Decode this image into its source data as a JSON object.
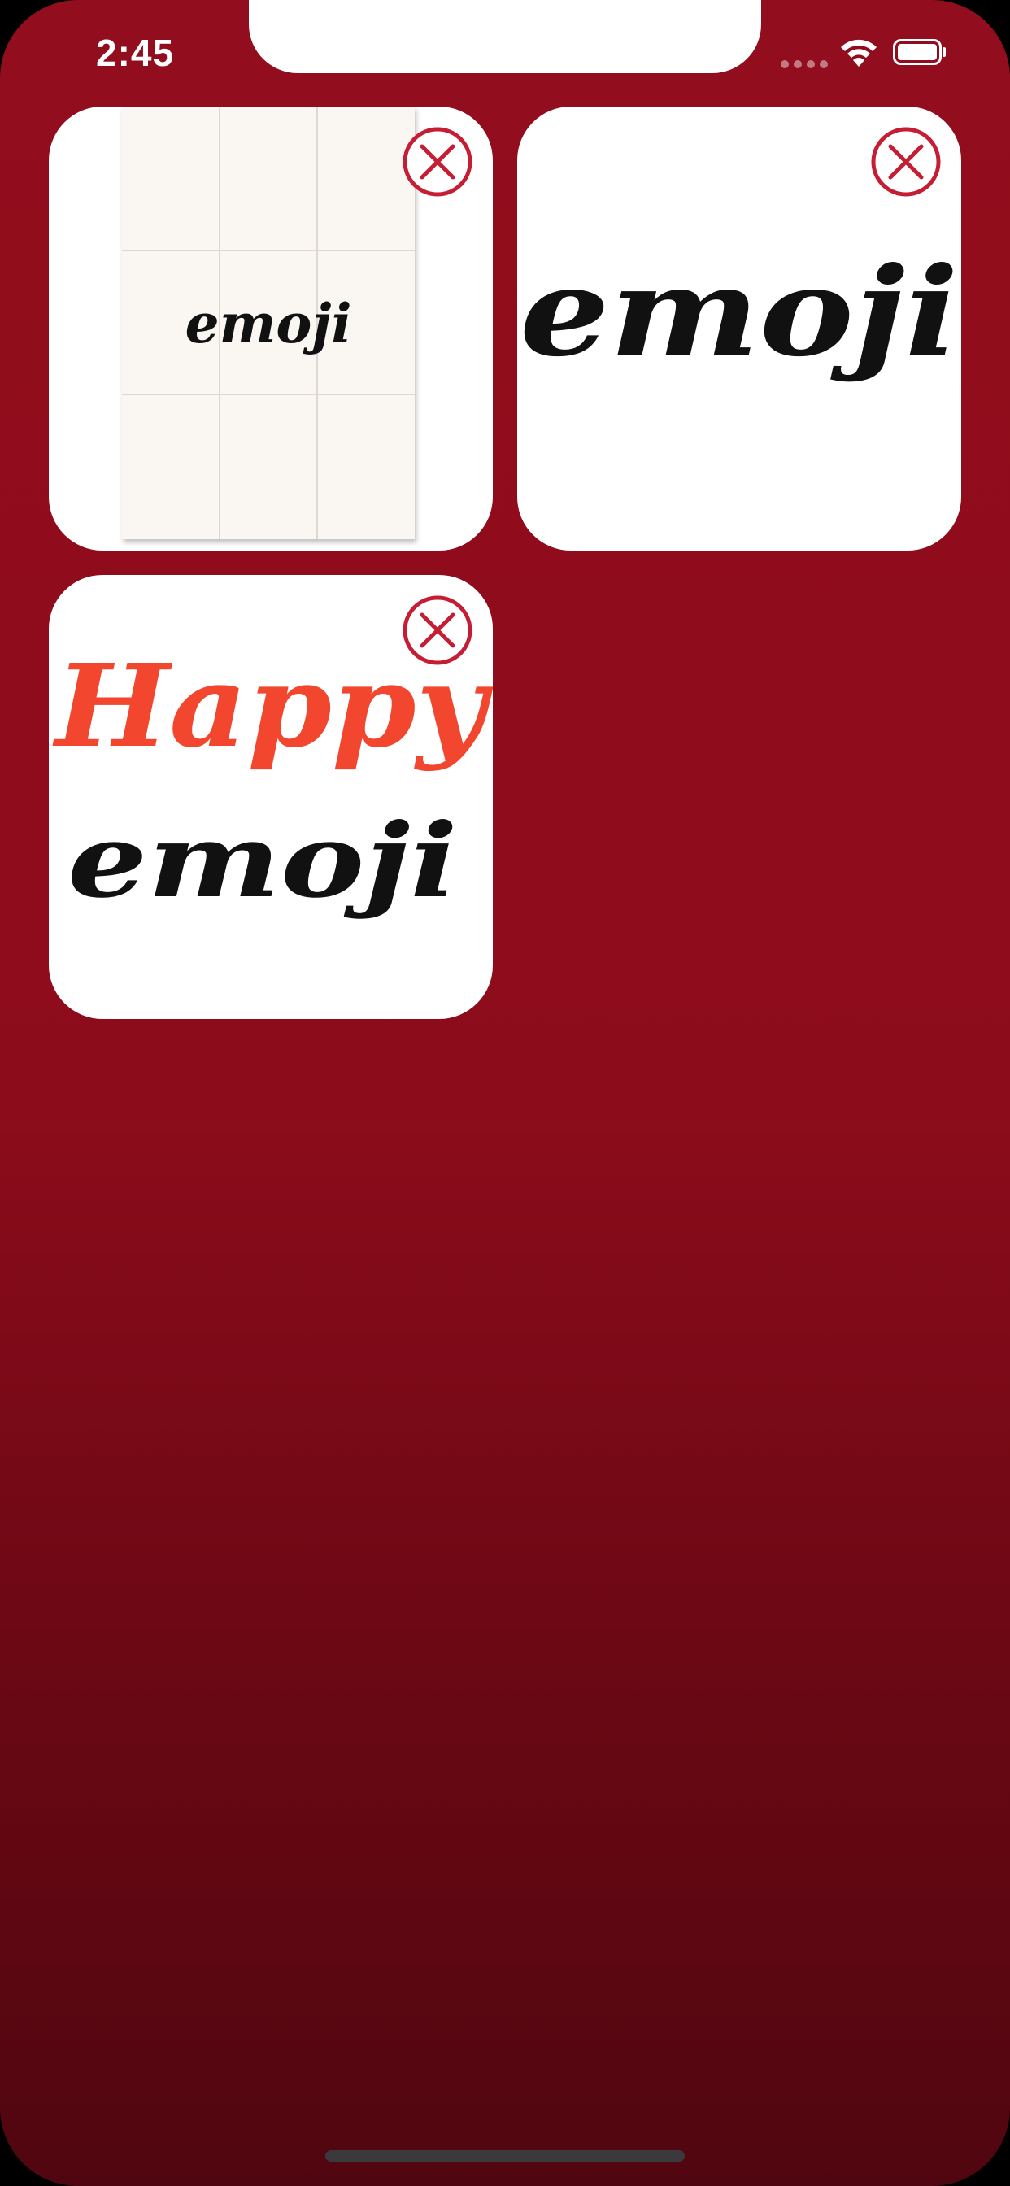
{
  "status_bar": {
    "time": "2:45",
    "icons": [
      "cellular-signal-icon",
      "wifi-icon",
      "battery-icon"
    ]
  },
  "colors": {
    "background_top": "#920d1d",
    "background_bottom": "#500610",
    "card_background": "#ffffff",
    "close_icon": "#c51d33",
    "happy_text": "#f2462e"
  },
  "stickers": [
    {
      "id": "sticker-1",
      "lines": [
        "emoji"
      ],
      "style": "grid paper"
    },
    {
      "id": "sticker-2",
      "lines": [
        "emoji"
      ],
      "style": "plain"
    },
    {
      "id": "sticker-3",
      "lines": [
        "Happy",
        "emoji"
      ],
      "style": "two-color"
    }
  ]
}
